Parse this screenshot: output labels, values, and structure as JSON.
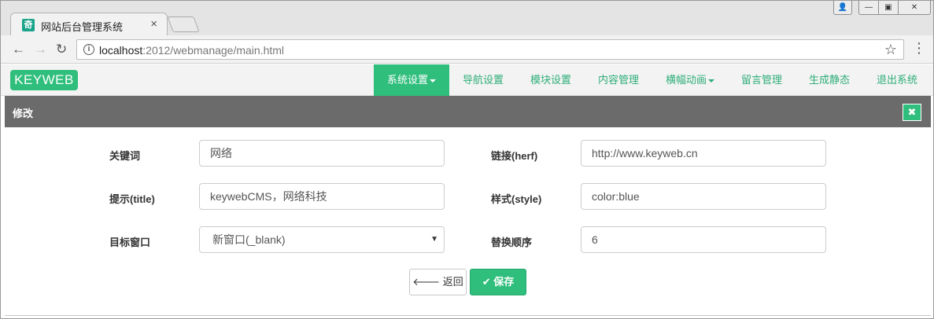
{
  "browser": {
    "tab_title": "网站后台管理系统",
    "tab_close": "×",
    "favicon_glyph": "奇",
    "url_host": "localhost",
    "url_path": ":2012/webmanage/main.html",
    "back_icon": "arrow-left-icon",
    "forward_icon": "arrow-right-icon",
    "reload_icon": "reload-icon",
    "info_glyph": "i",
    "bookmark_icon": "star-icon",
    "menu_icon": "kebab-menu-icon"
  },
  "site": {
    "logo": "KEYWEB",
    "accent_color": "#2fbe7c",
    "nav": [
      {
        "label": "系统设置",
        "active": true,
        "dropdown": true
      },
      {
        "label": "导航设置",
        "active": false,
        "dropdown": false
      },
      {
        "label": "模块设置",
        "active": false,
        "dropdown": false
      },
      {
        "label": "内容管理",
        "active": false,
        "dropdown": false
      },
      {
        "label": "横幅动画",
        "active": false,
        "dropdown": true
      },
      {
        "label": "留言管理",
        "active": false,
        "dropdown": false
      },
      {
        "label": "生成静态",
        "active": false,
        "dropdown": false
      },
      {
        "label": "退出系统",
        "active": false,
        "dropdown": false
      }
    ]
  },
  "panel": {
    "title": "修改",
    "close_glyph": "✖"
  },
  "form": {
    "keyword_label": "关键词",
    "keyword_value": "网络",
    "link_label": "链接(herf)",
    "link_value": "http://www.keyweb.cn",
    "title_label": "提示(title)",
    "title_value": "keywebCMS，网络科技",
    "style_label": "样式(style)",
    "style_value": "color:blue",
    "target_label": "目标窗口",
    "target_value": "新窗口(_blank)",
    "order_label": "替换顺序",
    "order_value": "6"
  },
  "buttons": {
    "back_label": "返回",
    "back_glyph": "🡐",
    "save_label": "保存",
    "save_glyph": "✔"
  }
}
